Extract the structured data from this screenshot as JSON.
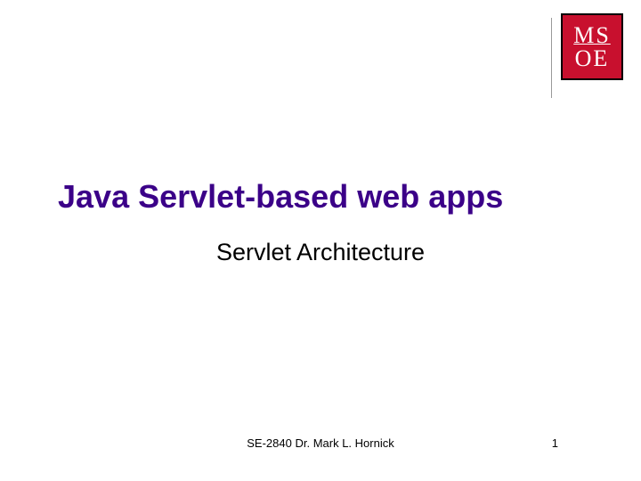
{
  "logo": {
    "line1": "MS",
    "line2": "OE"
  },
  "title": "Java Servlet-based web apps",
  "subtitle": "Servlet Architecture",
  "footer": {
    "text": "SE-2840 Dr. Mark L. Hornick",
    "page": "1"
  }
}
